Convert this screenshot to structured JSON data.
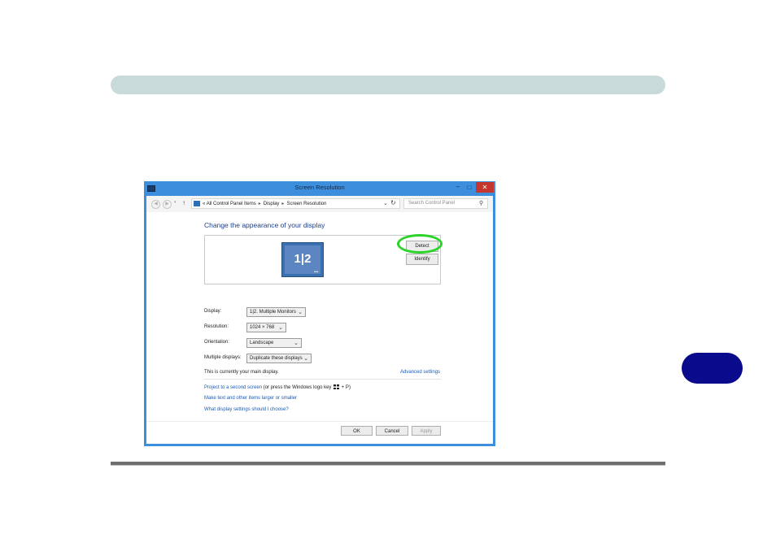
{
  "window": {
    "title": "Screen Resolution",
    "controls": {
      "minimize": "–",
      "maximize": "□",
      "close": "✕"
    }
  },
  "toolbar": {
    "back_icon": "arrow-left-icon",
    "forward_icon": "arrow-right-icon",
    "up_icon": "arrow-up-icon",
    "breadcrumb_prefix": "«",
    "breadcrumbs": [
      "All Control Panel Items",
      "Display",
      "Screen Resolution"
    ],
    "search_placeholder": "Search Control Panel"
  },
  "main": {
    "heading": "Change the appearance of your display",
    "monitor_label": "1|2",
    "detect_label": "Detect",
    "identify_label": "Identify",
    "fields": {
      "display": {
        "label": "Display:",
        "value": "1|2. Multiple Monitors"
      },
      "resolution": {
        "label": "Resolution:",
        "value": "1024 × 768"
      },
      "orientation": {
        "label": "Orientation:",
        "value": "Landscape"
      },
      "multiple": {
        "label": "Multiple displays:",
        "value": "Duplicate these displays"
      }
    },
    "main_display_note": "This is currently your main display.",
    "advanced_link": "Advanced settings",
    "project_link": "Project to a second screen",
    "project_text_before": "(or press the Windows logo key",
    "project_text_after": "+ P)",
    "text_size_link": "Make text and other items larger or smaller",
    "choose_link": "What display settings should I choose?"
  },
  "buttons": {
    "ok": "OK",
    "cancel": "Cancel",
    "apply": "Apply"
  },
  "colors": {
    "header_bar": "#c9dbd9",
    "chapter_badge": "#0a0a8c",
    "highlight": "#2ad42a",
    "window_frame": "#3d8fde"
  }
}
